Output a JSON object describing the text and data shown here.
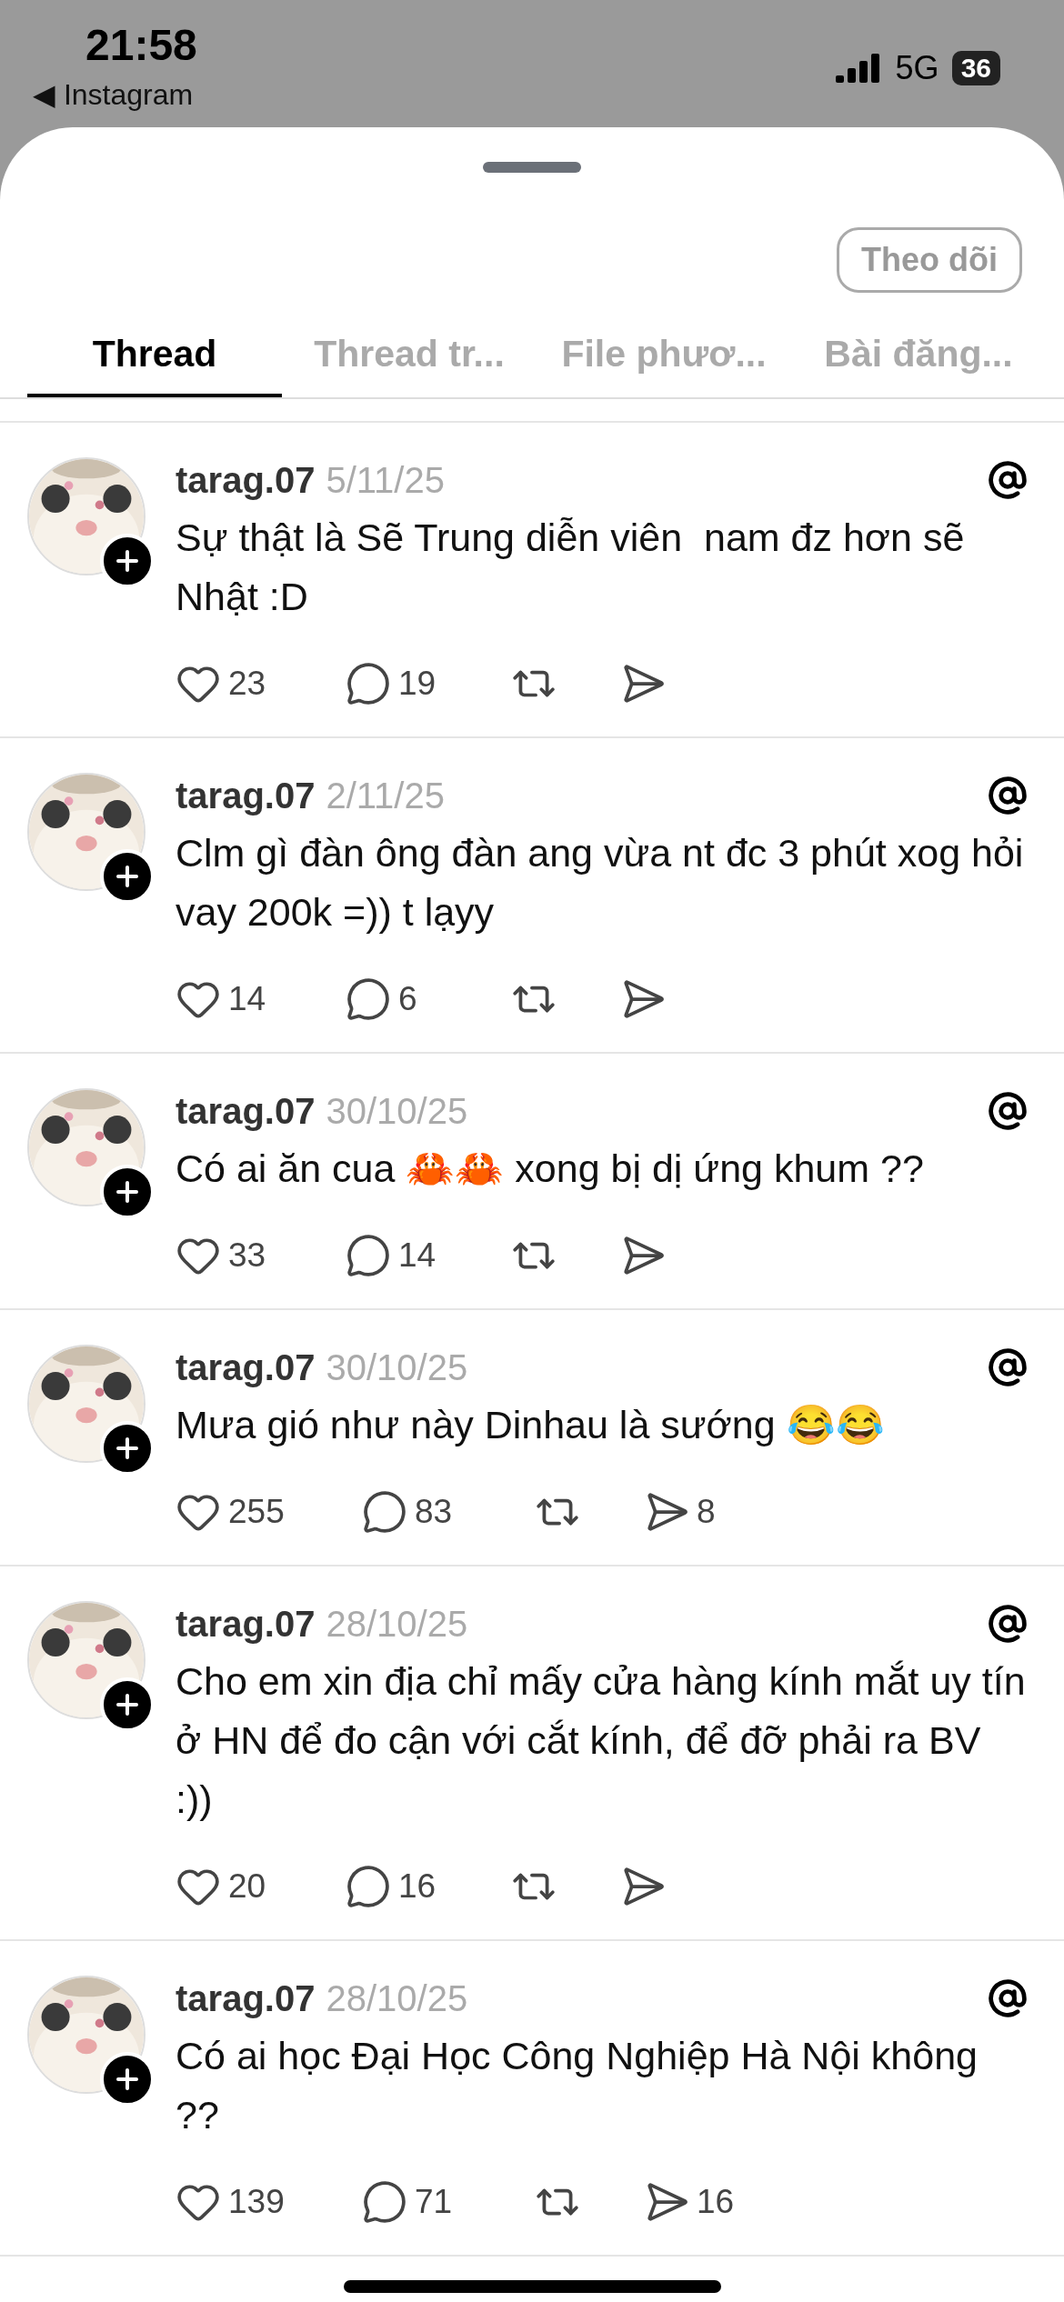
{
  "status_bar": {
    "time": "21:58",
    "back_label": "Instagram",
    "back_arrow": "◀",
    "network": "5G",
    "battery": "36"
  },
  "follow_button": "Theo dõi",
  "tabs": [
    {
      "label": "Thread",
      "selected": true
    },
    {
      "label": "Thread tr...",
      "selected": false
    },
    {
      "label": "File phươ...",
      "selected": false
    },
    {
      "label": "Bài đăng...",
      "selected": false
    }
  ],
  "posts": [
    {
      "username": "tarag.07",
      "date": "5/11/25",
      "text": "Sự thật là Sẽ Trung diễn viên  nam đz hơn sẽ Nhật :D",
      "likes": "23",
      "replies": "19"
    },
    {
      "username": "tarag.07",
      "date": "2/11/25",
      "text": "Clm gì đàn ông đàn ang vừa nt đc 3 phút xog hỏi vay 200k =)) t lạyy",
      "likes": "14",
      "replies": "6"
    },
    {
      "username": "tarag.07",
      "date": "30/10/25",
      "text": "Có ai ăn cua 🦀🦀 xong bị dị ứng khum ??",
      "likes": "33",
      "replies": "14"
    },
    {
      "username": "tarag.07",
      "date": "30/10/25",
      "text": "Mưa gió như này Dinhau là sướng 😂😂",
      "likes": "255",
      "replies": "83",
      "shares": "8"
    },
    {
      "username": "tarag.07",
      "date": "28/10/25",
      "text": "Cho em xin địa chỉ mấy cửa hàng kính mắt uy tín ở HN để đo cận với cắt kính, để đỡ phải ra BV :))",
      "likes": "20",
      "replies": "16"
    },
    {
      "username": "tarag.07",
      "date": "28/10/25",
      "text": "Có ai học Đại Học Công Nghiệp Hà Nội không ??",
      "likes": "139",
      "replies": "71",
      "shares": "16"
    }
  ]
}
